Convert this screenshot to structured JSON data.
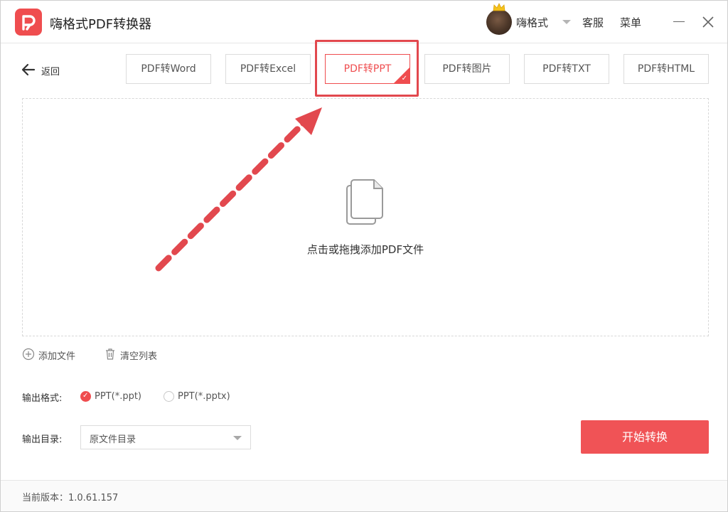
{
  "app": {
    "title": "嗨格式PDF转换器",
    "brand_color": "#ef4d4f"
  },
  "header": {
    "username": "嗨格式",
    "service_label": "客服",
    "menu_label": "菜单"
  },
  "toolbar": {
    "back_label": "返回",
    "tabs": [
      {
        "label": "PDF转Word",
        "active": false
      },
      {
        "label": "PDF转Excel",
        "active": false
      },
      {
        "label": "PDF转PPT",
        "active": true
      },
      {
        "label": "PDF转图片",
        "active": false
      },
      {
        "label": "PDF转TXT",
        "active": false
      },
      {
        "label": "PDF转HTML",
        "active": false
      }
    ]
  },
  "dropzone": {
    "hint": "点击或拖拽添加PDF文件"
  },
  "file_actions": {
    "add_label": "添加文件",
    "clear_label": "清空列表"
  },
  "output_format": {
    "label": "输出格式:",
    "options": [
      {
        "label": "PPT(*.ppt)",
        "selected": true
      },
      {
        "label": "PPT(*.pptx)",
        "selected": false
      }
    ]
  },
  "output_dir": {
    "label": "输出目录:",
    "value": "原文件目录"
  },
  "start_button": {
    "label": "开始转换"
  },
  "footer": {
    "version_text": "当前版本：1.0.61.157"
  },
  "annotation": {
    "color": "#e2484e"
  }
}
